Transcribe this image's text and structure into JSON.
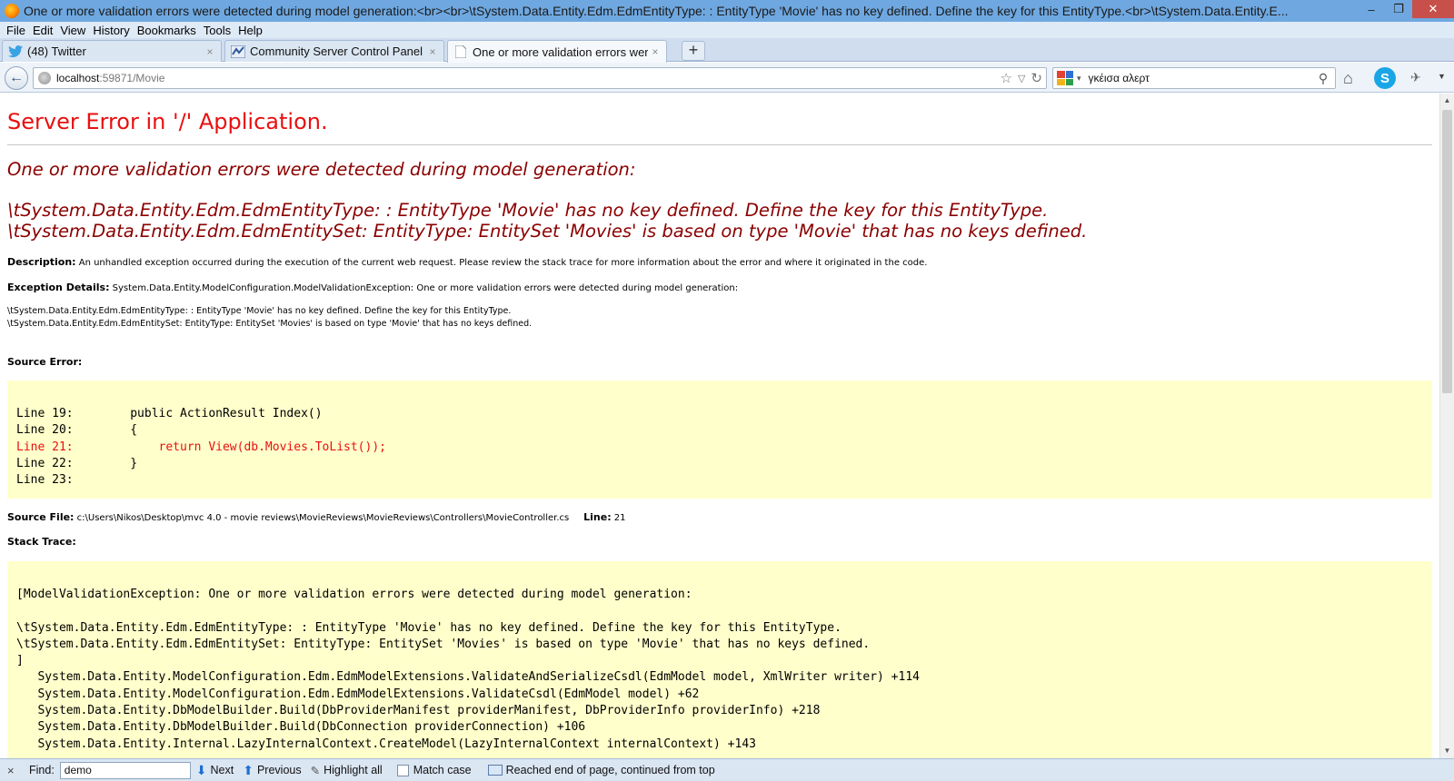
{
  "window": {
    "title": "One or more validation errors were detected during model generation:<br><br>\\tSystem.Data.Entity.Edm.EdmEntityType: : EntityType 'Movie' has no key defined. Define the key for this EntityType.<br>\\tSystem.Data.Entity.E...",
    "minimize": "–",
    "restore": "❐",
    "close": "✕"
  },
  "menu": {
    "items": [
      "File",
      "Edit",
      "View",
      "History",
      "Bookmarks",
      "Tools",
      "Help"
    ]
  },
  "tabs": [
    {
      "label": "(48) Twitter",
      "icon": "twitter-icon",
      "close": "×"
    },
    {
      "label": "Community Server Control Panel",
      "icon": "aspnet-icon",
      "close": "×"
    },
    {
      "label": "One or more validation errors were d...",
      "icon": "page-icon",
      "close": "×"
    }
  ],
  "new_tab": "+",
  "nav": {
    "back": "←",
    "url_host": "localhost",
    "url_path": ":59871/Movie",
    "bookmark_star": "☆",
    "dropdown": "▽",
    "reload": "↻",
    "search_value": "γκέισα αλερτ",
    "search_dropdown": "▾",
    "search_icon": "⚲",
    "home": "⌂",
    "skype": "S",
    "ext": "✈",
    "menu_dropdown": "▼"
  },
  "page": {
    "title": "Server Error in '/' Application.",
    "heading_line1": "One or more validation errors were detected during model generation:",
    "heading_line2": "\\tSystem.Data.Entity.Edm.EdmEntityType: : EntityType 'Movie' has no key defined. Define the key for this EntityType.",
    "heading_line3": "\\tSystem.Data.Entity.Edm.EdmEntitySet: EntityType: EntitySet 'Movies' is based on type 'Movie' that has no keys defined.",
    "description_label": "Description:",
    "description_text": " An unhandled exception occurred during the execution of the current web request. Please review the stack trace for more information about the error and where it originated in the code.",
    "exception_label": "Exception Details:",
    "exception_text": " System.Data.Entity.ModelConfiguration.ModelValidationException: One or more validation errors were detected during model generation:",
    "exception_line1": "\\tSystem.Data.Entity.Edm.EdmEntityType: : EntityType 'Movie' has no key defined. Define the key for this EntityType.",
    "exception_line2": "\\tSystem.Data.Entity.Edm.EdmEntitySet: EntityType: EntitySet 'Movies' is based on type 'Movie' that has no keys defined.",
    "source_error_label": "Source Error:",
    "source_lines": [
      "Line 19:        public ActionResult Index()",
      "Line 20:        {",
      "Line 21:            return View(db.Movies.ToList());",
      "Line 22:        }",
      "Line 23:"
    ],
    "source_file_label": "Source File:",
    "source_file_path": " c:\\Users\\Nikos\\Desktop\\mvc 4.0 - movie reviews\\MovieReviews\\MovieReviews\\Controllers\\MovieController.cs",
    "line_label": "Line:",
    "line_number": " 21",
    "stack_trace_label": "Stack Trace:",
    "stack_lines": [
      "[ModelValidationException: One or more validation errors were detected during model generation:",
      "",
      "\\tSystem.Data.Entity.Edm.EdmEntityType: : EntityType 'Movie' has no key defined. Define the key for this EntityType.",
      "\\tSystem.Data.Entity.Edm.EdmEntitySet: EntityType: EntitySet 'Movies' is based on type 'Movie' that has no keys defined.",
      "]",
      "   System.Data.Entity.ModelConfiguration.Edm.EdmModelExtensions.ValidateAndSerializeCsdl(EdmModel model, XmlWriter writer) +114",
      "   System.Data.Entity.ModelConfiguration.Edm.EdmModelExtensions.ValidateCsdl(EdmModel model) +62",
      "   System.Data.Entity.DbModelBuilder.Build(DbProviderManifest providerManifest, DbProviderInfo providerInfo) +218",
      "   System.Data.Entity.DbModelBuilder.Build(DbConnection providerConnection) +106",
      "   System.Data.Entity.Internal.LazyInternalContext.CreateModel(LazyInternalContext internalContext) +143"
    ]
  },
  "findbar": {
    "close": "×",
    "label": "Find:",
    "value": "demo",
    "next": "Next",
    "previous": "Previous",
    "highlight_all": "Highlight all",
    "match_case": "Match case",
    "status": "Reached end of page, continued from top"
  },
  "colors": {
    "error_red": "#e81010",
    "heading_maroon": "#8b0000",
    "code_bg": "#ffffcc"
  }
}
